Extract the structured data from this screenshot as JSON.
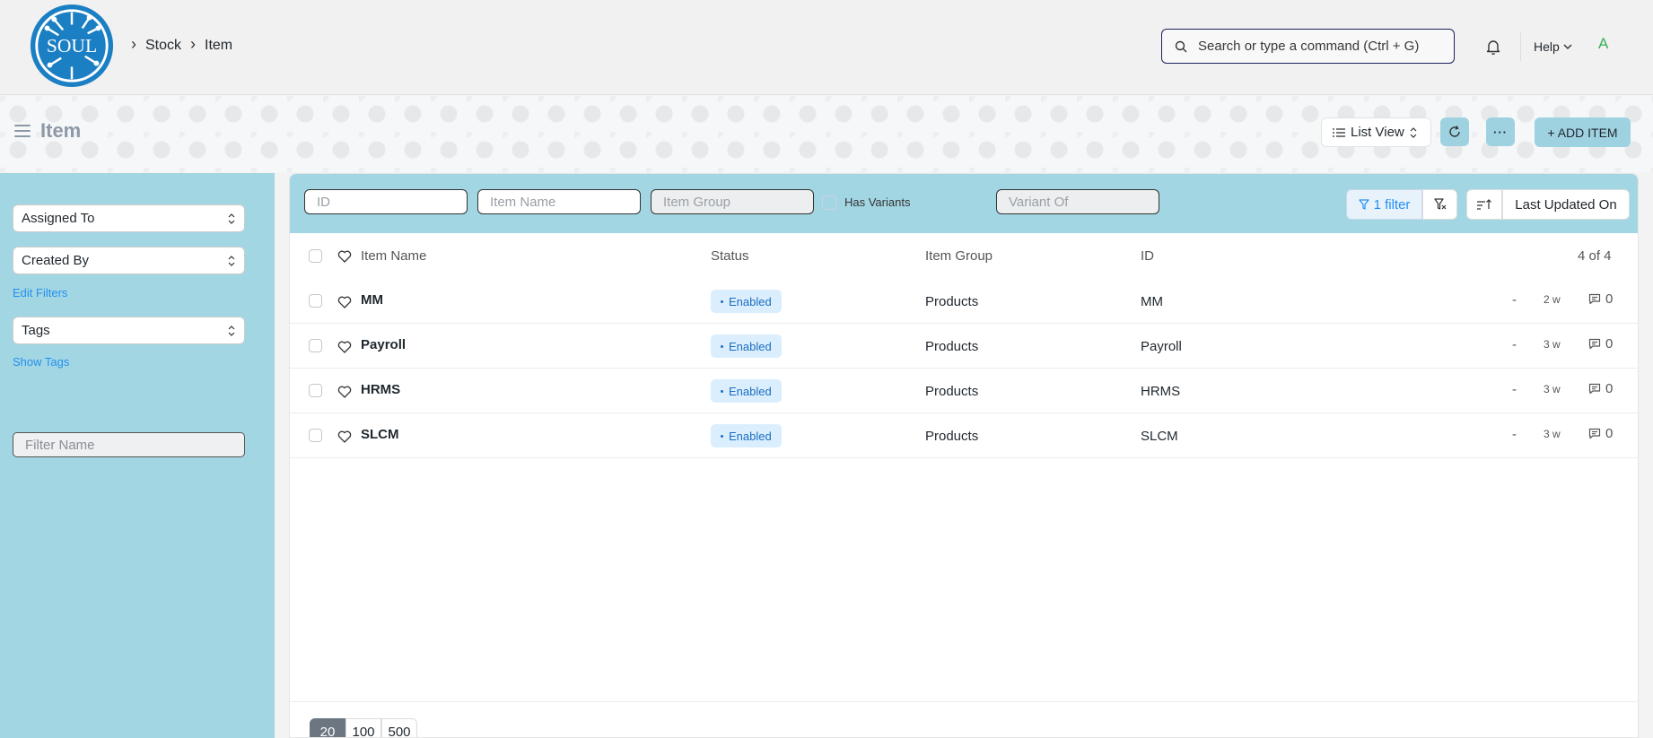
{
  "navbar": {
    "logo_text": "SOUL",
    "breadcrumbs": [
      "Stock",
      "Item"
    ],
    "search_placeholder": "Search or type a command (Ctrl + G)",
    "help_label": "Help",
    "avatar_initial": "A"
  },
  "page": {
    "title": "Item",
    "view_label": "List View",
    "more_label": "···",
    "add_label": "+ ADD ITEM"
  },
  "sidebar": {
    "assigned_to": "Assigned To",
    "created_by": "Created By",
    "edit_filters": "Edit Filters",
    "tags": "Tags",
    "show_tags": "Show Tags",
    "filter_name_placeholder": "Filter Name"
  },
  "filters": {
    "id_placeholder": "ID",
    "item_name_placeholder": "Item Name",
    "item_group_placeholder": "Item Group",
    "has_variants_label": "Has Variants",
    "variant_of_placeholder": "Variant Of",
    "filter_count_label": "1 filter",
    "sort_label": "Last Updated On"
  },
  "list": {
    "columns": {
      "name": "Item Name",
      "status": "Status",
      "group": "Item Group",
      "id": "ID",
      "count": "4 of 4"
    },
    "rows": [
      {
        "name": "MM",
        "status": "Enabled",
        "group": "Products",
        "id": "MM",
        "dash": "-",
        "age": "2 w",
        "comments": "0"
      },
      {
        "name": "Payroll",
        "status": "Enabled",
        "group": "Products",
        "id": "Payroll",
        "dash": "-",
        "age": "3 w",
        "comments": "0"
      },
      {
        "name": "HRMS",
        "status": "Enabled",
        "group": "Products",
        "id": "HRMS",
        "dash": "-",
        "age": "3 w",
        "comments": "0"
      },
      {
        "name": "SLCM",
        "status": "Enabled",
        "group": "Products",
        "id": "SLCM",
        "dash": "-",
        "age": "3 w",
        "comments": "0"
      }
    ]
  },
  "pager": {
    "sizes": [
      "20",
      "100",
      "500"
    ],
    "active": "20"
  },
  "colors": {
    "accent": "#a3d6e3",
    "link": "#2490ef",
    "badge_bg": "#dbeefe"
  }
}
